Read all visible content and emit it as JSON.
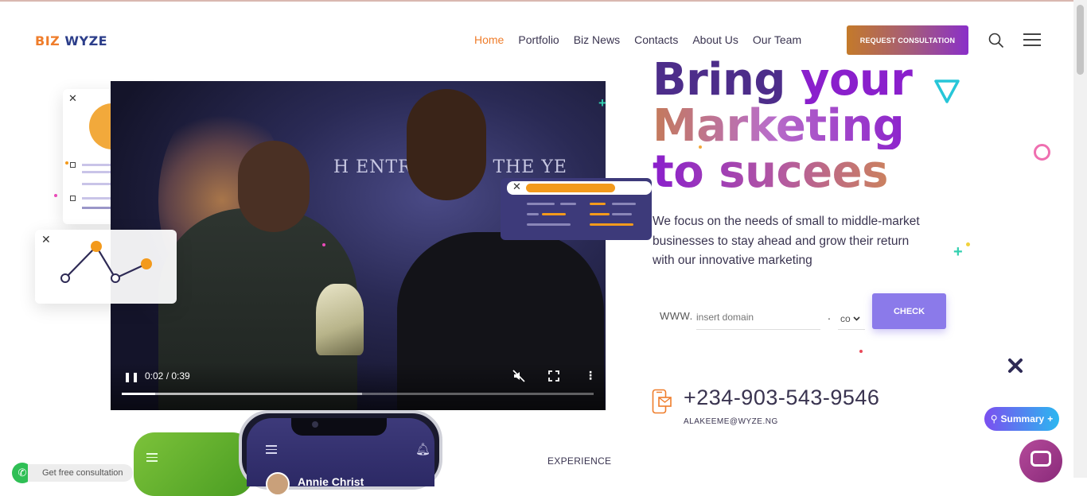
{
  "header": {
    "logo_part1": "BIZ",
    "logo_part2": "WYZE",
    "nav": [
      {
        "label": "Home",
        "active": true
      },
      {
        "label": "Portfolio",
        "active": false
      },
      {
        "label": "Biz News",
        "active": false
      },
      {
        "label": "Contacts",
        "active": false
      },
      {
        "label": "About Us",
        "active": false
      },
      {
        "label": "Our Team",
        "active": false
      }
    ],
    "cta_label": "REQUEST CONSULTATION",
    "search_icon": "search-icon",
    "menu_icon": "hamburger-menu-icon"
  },
  "video": {
    "banner_text": "H ENTREPR   OF THE YE",
    "time": "0:02 / 0:39",
    "progress": 0.07,
    "buffered": 0.51,
    "play_state_icon": "pause-icon",
    "mute_icon": "muted-icon",
    "fullscreen_icon": "fullscreen-icon",
    "more_icon": "more-vertical-icon"
  },
  "hero": {
    "headline_line1_a": "Bring",
    "headline_line1_b": "your",
    "headline_line2": "Marketing",
    "headline_line3": "to sucees",
    "lead": "We focus on the needs of small to middle-market businesses to stay ahead and grow their return with our innovative marketing"
  },
  "domain_search": {
    "prefix": "WWW.",
    "placeholder": "insert domain",
    "dot": ".",
    "tld_value": "co",
    "button_label": "CHECK"
  },
  "contact": {
    "phone": "+234-903-543-9546",
    "email": "ALAKEEME@WYZE.NG"
  },
  "section_label": "EXPERIENCE",
  "phone_mockup": {
    "user_name": "Annie Christ"
  },
  "widgets": {
    "whatsapp_label": "Get free consultation",
    "summary_label": "Summary",
    "summary_plus": "+"
  },
  "colors": {
    "accent_orange": "#ef7d2b",
    "brand_purple": "#8a1fcc",
    "check_button": "#8b7aea"
  }
}
